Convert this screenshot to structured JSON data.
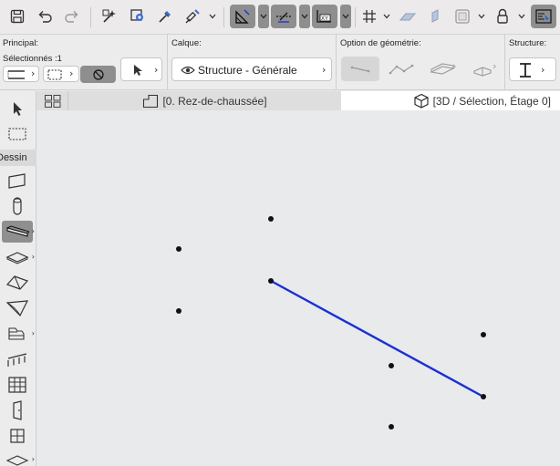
{
  "toolbar": {
    "buttons": [
      {
        "name": "save-icon"
      },
      {
        "name": "undo-icon"
      },
      {
        "name": "redo-icon"
      },
      {
        "name": "magic-wand-icon"
      },
      {
        "name": "edit-selection-icon"
      },
      {
        "name": "pick-up-eyedropper-icon"
      },
      {
        "name": "inject-syringe-icon"
      },
      {
        "name": "guide-lines-icon"
      },
      {
        "name": "snap-guides-icon"
      },
      {
        "name": "coordinates-xy-icon"
      },
      {
        "name": "grid-snap-icon"
      },
      {
        "name": "plane-icon"
      },
      {
        "name": "vertical-plane-icon"
      },
      {
        "name": "3d-cutaway-icon"
      },
      {
        "name": "lock-icon"
      },
      {
        "name": "renovation-icon"
      }
    ]
  },
  "infobox": {
    "principal": {
      "label": "Principal:",
      "selected": "Sélectionnés :1"
    },
    "calque": {
      "label": "Calque:",
      "value": "Structure - Générale"
    },
    "geometry": {
      "label": "Option de géométrie:"
    },
    "structure": {
      "label": "Structure:"
    }
  },
  "tabs": {
    "floor_plan": "[0. Rez-de-chaussée]",
    "view_3d": "[3D / Sélection, Étage 0]"
  },
  "toolbox": {
    "section_label": "Dessin",
    "tools": [
      "arrow-selection-icon",
      "marquee-icon",
      "wall-icon",
      "column-icon",
      "beam-icon",
      "slab-icon",
      "roof-icon",
      "shell-icon",
      "stair-icon",
      "railing-icon",
      "curtain-wall-icon",
      "door-icon",
      "window-icon",
      "skylight-icon"
    ]
  },
  "canvas": {
    "selection_color": "#1a2fd6",
    "hotspot_color": "#111111",
    "background": "#e8eaeb"
  }
}
